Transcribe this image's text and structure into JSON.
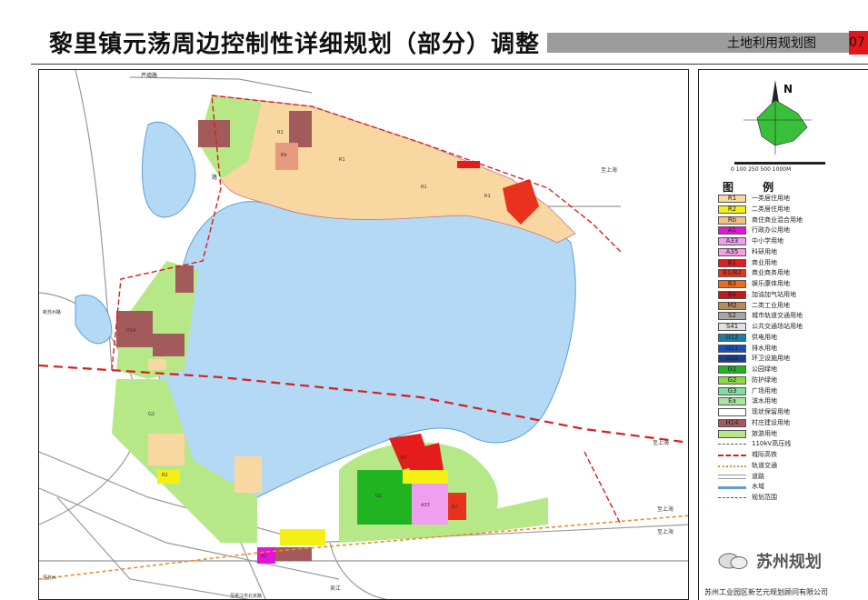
{
  "header": {
    "title": "黎里镇元荡周边控制性详细规划（部分）调整",
    "subtitle": "土地利用规划图",
    "sheet_number": "07"
  },
  "north": {
    "label": "N",
    "scale": "0  100   250          500                  1000M"
  },
  "legend": {
    "title": "图  例",
    "items": [
      {
        "code": "R1",
        "label": "一类居住用地",
        "color": "#f9d7a1"
      },
      {
        "code": "R2",
        "label": "二类居住用地",
        "color": "#f5f014"
      },
      {
        "code": "Rb",
        "label": "商住商业混合用地",
        "color": "#f4c08a"
      },
      {
        "code": "A1",
        "label": "行政办公用地",
        "color": "#e215d7"
      },
      {
        "code": "A33",
        "label": "中小学用地",
        "color": "#f09ef0"
      },
      {
        "code": "A35",
        "label": "科研用地",
        "color": "#f2a1dc"
      },
      {
        "code": "B1",
        "label": "商业用地",
        "color": "#e41c1c"
      },
      {
        "code": "B1/B2",
        "label": "商业商务用地",
        "color": "#e8321c"
      },
      {
        "code": "B3",
        "label": "娱乐康体用地",
        "color": "#ef6a1d"
      },
      {
        "code": "B4",
        "label": "加油加气站用地",
        "color": "#c11a1a"
      },
      {
        "code": "M2",
        "label": "二类工业用地",
        "color": "#b78a56"
      },
      {
        "code": "S2",
        "label": "城市轨道交通用地",
        "color": "#a6a6a6"
      },
      {
        "code": "S41",
        "label": "公共交通场站用地",
        "color": "#e0e0e0"
      },
      {
        "code": "U12",
        "label": "供电用地",
        "color": "#1c7ea3"
      },
      {
        "code": "U21",
        "label": "排水用地",
        "color": "#1a4fb5"
      },
      {
        "code": "U22",
        "label": "环卫设施用地",
        "color": "#1a3c8c"
      },
      {
        "code": "G1",
        "label": "公园绿地",
        "color": "#21b421"
      },
      {
        "code": "G2",
        "label": "防护绿地",
        "color": "#8dd846"
      },
      {
        "code": "G3",
        "label": "广场用地",
        "color": "#7ee0a0"
      },
      {
        "code": "Ea",
        "label": "滨水用地",
        "color": "#a5e89a"
      },
      {
        "code": "",
        "label": "现状保留用地",
        "color": "#ffffff"
      },
      {
        "code": "H14",
        "label": "村庄建设用地",
        "color": "#a35a5a"
      },
      {
        "code": "",
        "label": "旅游用地",
        "color": "#b6e887"
      },
      {
        "code": "",
        "label": "110kV高压线",
        "color": "line-110"
      },
      {
        "code": "",
        "label": "城际高铁",
        "color": "line-rail"
      },
      {
        "code": "",
        "label": "轨道交通",
        "color": "line-metro"
      },
      {
        "code": "",
        "label": "道路",
        "color": "line-road"
      },
      {
        "code": "",
        "label": "水域",
        "color": "line-water"
      },
      {
        "code": "",
        "label": "规划范围",
        "color": "line-boundary"
      }
    ]
  },
  "map_labels": {
    "north_road": "芦墟路",
    "east_road_1": "至上海",
    "east_road_2": "至上海",
    "east_road_3": "至上海",
    "east_road_4": "至上海",
    "west_1": "新苏州路",
    "west_2": "至苏州",
    "bottom_road": "至吴江市北京路",
    "wu_jiang": "吴江",
    "road_lu": "路",
    "land_tags": [
      "R1",
      "R1",
      "R1",
      "R1",
      "R2",
      "Rb",
      "B1",
      "B1",
      "A33",
      "A1",
      "G1",
      "H14",
      "G2"
    ]
  },
  "branding": {
    "watermark": "苏州规划",
    "company": "苏州工业园区新艺元规划顾问有限公司"
  }
}
